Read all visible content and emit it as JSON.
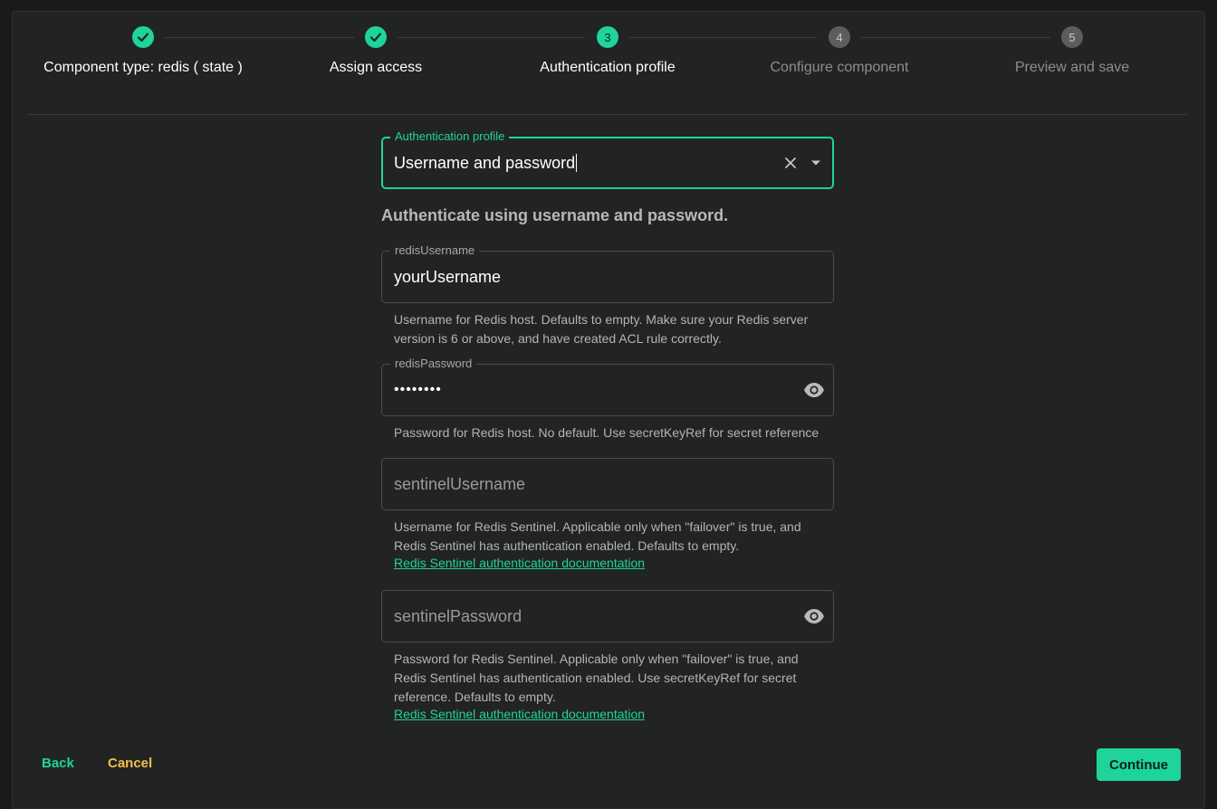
{
  "stepper": {
    "steps": [
      {
        "number": "",
        "label": "Component type: redis ( state )",
        "status": "done",
        "icon": "check-icon"
      },
      {
        "number": "",
        "label": "Assign access",
        "status": "done",
        "icon": "check-icon"
      },
      {
        "number": "3",
        "label": "Authentication profile",
        "status": "active"
      },
      {
        "number": "4",
        "label": "Configure component",
        "status": "pending"
      },
      {
        "number": "5",
        "label": "Preview and save",
        "status": "pending"
      }
    ]
  },
  "auth_profile": {
    "legend": "Authentication profile",
    "value": "Username and password",
    "clear_icon": "close-icon",
    "dropdown_icon": "caret-down-icon"
  },
  "section_heading": "Authenticate using username and password.",
  "fields": {
    "redis_username": {
      "legend": "redisUsername",
      "value": "yourUsername",
      "helper": "Username for Redis host. Defaults to empty. Make sure your Redis server version is 6 or above, and have created ACL rule correctly."
    },
    "redis_password": {
      "legend": "redisPassword",
      "value": "••••••••",
      "helper": "Password for Redis host. No default. Use secretKeyRef for secret reference",
      "toggle_icon": "eye-icon"
    },
    "sentinel_username": {
      "placeholder": "sentinelUsername",
      "helper": "Username for Redis Sentinel. Applicable only when \"failover\" is true, and Redis Sentinel has authentication enabled. Defaults to empty.",
      "link": "Redis Sentinel authentication documentation"
    },
    "sentinel_password": {
      "placeholder": "sentinelPassword",
      "helper": "Password for Redis Sentinel. Applicable only when \"failover\" is true, and Redis Sentinel has authentication enabled. Use secretKeyRef for secret reference. Defaults to empty.",
      "link": "Redis Sentinel authentication documentation",
      "toggle_icon": "eye-icon"
    }
  },
  "footer": {
    "back_label": "Back",
    "cancel_label": "Cancel",
    "continue_label": "Continue"
  },
  "colors": {
    "accent": "#1ed49b",
    "cancel": "#f0c04a",
    "background": "#222323"
  }
}
